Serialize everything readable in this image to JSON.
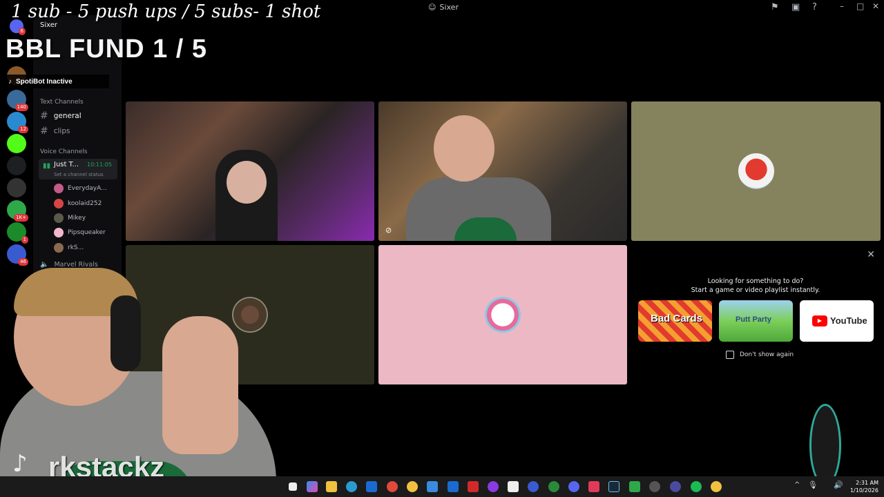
{
  "window": {
    "title": "Sixer",
    "title_icon": "discord-logo-icon"
  },
  "overlay": {
    "top_text": "1 sub - 5 push ups / 5 subs- 1 shot",
    "fund_text": "BBL FUND  1 / 5",
    "spotibot": "SpotiBot Inactive",
    "streamer_name": "rkstackz"
  },
  "sidebar": {
    "server_name": "Sixer",
    "categories": {
      "text": "Text Channels",
      "voice": "Voice Channels"
    },
    "text_channels": [
      {
        "name": "general"
      },
      {
        "name": "clips"
      }
    ],
    "voice_channel": {
      "name": "Just T...",
      "time": "10:11:05",
      "status": "Set a channel status"
    },
    "members": [
      {
        "name": "EverydayA...",
        "color": "#c25b8a"
      },
      {
        "name": "koolaid252",
        "color": "#d64545"
      },
      {
        "name": "Mikey",
        "color": "#5a5a4a"
      },
      {
        "name": "Pipsqueaker",
        "color": "#f0b8c8"
      },
      {
        "name": "rkS...",
        "color": "#8a6a52"
      }
    ],
    "next_voice": "Marvel Rivals"
  },
  "guild_badges": [
    "6",
    "140",
    "12",
    "1K+",
    "1",
    "46"
  ],
  "activity": {
    "line1": "Looking for something to do?",
    "line2": "Start a game or video playlist instantly.",
    "cards": [
      {
        "label": "Bad Cards",
        "color": "#e23a2e"
      },
      {
        "label": "Putt Party",
        "color": "#6fbf58"
      },
      {
        "label": "YouTube",
        "color": "#ffffff"
      }
    ],
    "dont_show": "Don't show again"
  },
  "taskbar": {
    "time": "2:31 AM",
    "date": "1/10/2026"
  },
  "colors": {
    "tile_olive": "#85835e",
    "tile_dark": "#2c2c1e",
    "tile_pink": "#ecb8c4",
    "speaking": "#23a55a"
  }
}
